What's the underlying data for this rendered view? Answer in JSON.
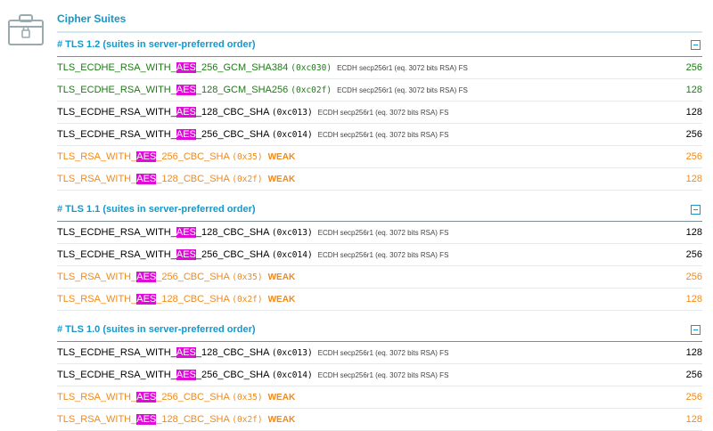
{
  "section_title": "Cipher Suites",
  "icon": "lock-briefcase-icon",
  "colors": {
    "accent": "#1797c9",
    "strong": "#1d7b15",
    "weak": "#f08a1c",
    "highlight": "#e00bd8"
  },
  "protocols": [
    {
      "title": "# TLS 1.2 (suites in server-preferred order)",
      "suites": [
        {
          "prefix": "TLS_ECDHE_RSA_WITH_",
          "hl": "AES",
          "suffix": "_256_GCM_SHA384",
          "code": "(0xc030)",
          "info": "ECDH secp256r1 (eq. 3072 bits RSA)   FS",
          "weak": "",
          "bits": "256",
          "color": "green"
        },
        {
          "prefix": "TLS_ECDHE_RSA_WITH_",
          "hl": "AES",
          "suffix": "_128_GCM_SHA256",
          "code": "(0xc02f)",
          "info": "ECDH secp256r1 (eq. 3072 bits RSA)   FS",
          "weak": "",
          "bits": "128",
          "color": "green"
        },
        {
          "prefix": "TLS_ECDHE_RSA_WITH_",
          "hl": "AES",
          "suffix": "_128_CBC_SHA",
          "code": "(0xc013)",
          "info": "ECDH secp256r1 (eq. 3072 bits RSA)   FS",
          "weak": "",
          "bits": "128",
          "color": "black"
        },
        {
          "prefix": "TLS_ECDHE_RSA_WITH_",
          "hl": "AES",
          "suffix": "_256_CBC_SHA",
          "code": "(0xc014)",
          "info": "ECDH secp256r1 (eq. 3072 bits RSA)   FS",
          "weak": "",
          "bits": "256",
          "color": "black"
        },
        {
          "prefix": "TLS_RSA_WITH_",
          "hl": "AES",
          "suffix": "_256_CBC_SHA",
          "code": "(0x35)",
          "info": "",
          "weak": "WEAK",
          "bits": "256",
          "color": "orange"
        },
        {
          "prefix": "TLS_RSA_WITH_",
          "hl": "AES",
          "suffix": "_128_CBC_SHA",
          "code": "(0x2f)",
          "info": "",
          "weak": "WEAK",
          "bits": "128",
          "color": "orange"
        }
      ]
    },
    {
      "title": "# TLS 1.1 (suites in server-preferred order)",
      "suites": [
        {
          "prefix": "TLS_ECDHE_RSA_WITH_",
          "hl": "AES",
          "suffix": "_128_CBC_SHA",
          "code": "(0xc013)",
          "info": "ECDH secp256r1 (eq. 3072 bits RSA)   FS",
          "weak": "",
          "bits": "128",
          "color": "black"
        },
        {
          "prefix": "TLS_ECDHE_RSA_WITH_",
          "hl": "AES",
          "suffix": "_256_CBC_SHA",
          "code": "(0xc014)",
          "info": "ECDH secp256r1 (eq. 3072 bits RSA)   FS",
          "weak": "",
          "bits": "256",
          "color": "black"
        },
        {
          "prefix": "TLS_RSA_WITH_",
          "hl": "AES",
          "suffix": "_256_CBC_SHA",
          "code": "(0x35)",
          "info": "",
          "weak": "WEAK",
          "bits": "256",
          "color": "orange"
        },
        {
          "prefix": "TLS_RSA_WITH_",
          "hl": "AES",
          "suffix": "_128_CBC_SHA",
          "code": "(0x2f)",
          "info": "",
          "weak": "WEAK",
          "bits": "128",
          "color": "orange"
        }
      ]
    },
    {
      "title": "# TLS 1.0 (suites in server-preferred order)",
      "suites": [
        {
          "prefix": "TLS_ECDHE_RSA_WITH_",
          "hl": "AES",
          "suffix": "_128_CBC_SHA",
          "code": "(0xc013)",
          "info": "ECDH secp256r1 (eq. 3072 bits RSA)   FS",
          "weak": "",
          "bits": "128",
          "color": "black"
        },
        {
          "prefix": "TLS_ECDHE_RSA_WITH_",
          "hl": "AES",
          "suffix": "_256_CBC_SHA",
          "code": "(0xc014)",
          "info": "ECDH secp256r1 (eq. 3072 bits RSA)   FS",
          "weak": "",
          "bits": "256",
          "color": "black"
        },
        {
          "prefix": "TLS_RSA_WITH_",
          "hl": "AES",
          "suffix": "_256_CBC_SHA",
          "code": "(0x35)",
          "info": "",
          "weak": "WEAK",
          "bits": "256",
          "color": "orange"
        },
        {
          "prefix": "TLS_RSA_WITH_",
          "hl": "AES",
          "suffix": "_128_CBC_SHA",
          "code": "(0x2f)",
          "info": "",
          "weak": "WEAK",
          "bits": "128",
          "color": "orange"
        }
      ]
    }
  ]
}
